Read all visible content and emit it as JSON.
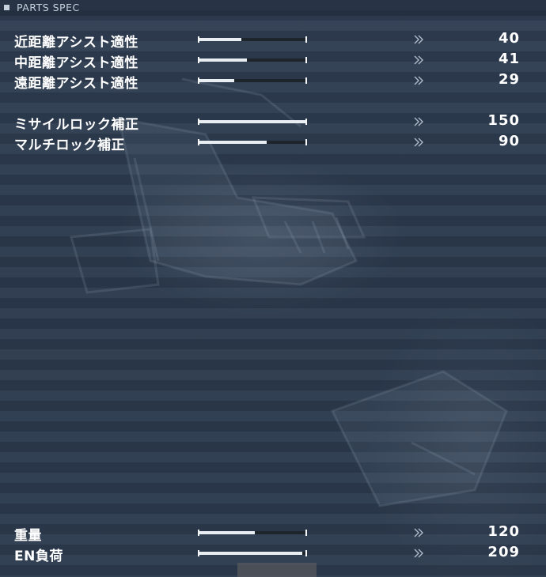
{
  "panel": {
    "title": "PARTS SPEC",
    "icon": "square-bullet-icon"
  },
  "colors": {
    "background": "#2b394d",
    "bar_fill": "#e9eef2",
    "bar_track": "#1e242c",
    "text": "#ffffff"
  },
  "stats": [
    {
      "label": "近距離アシスト適性",
      "value": "40",
      "fill": 0.4
    },
    {
      "label": "中距離アシスト適性",
      "value": "41",
      "fill": 0.45
    },
    {
      "label": "遠距離アシスト適性",
      "value": "29",
      "fill": 0.33
    },
    {
      "label": "ミサイルロック補正",
      "value": "150",
      "fill": 1.0
    },
    {
      "label": "マルチロック補正",
      "value": "90",
      "fill": 0.63
    },
    {
      "label": "重量",
      "value": "120",
      "fill": 0.52
    },
    {
      "label": "EN負荷",
      "value": "209",
      "fill": 0.96
    }
  ],
  "chevron_icon": "double-chevron-right-icon"
}
